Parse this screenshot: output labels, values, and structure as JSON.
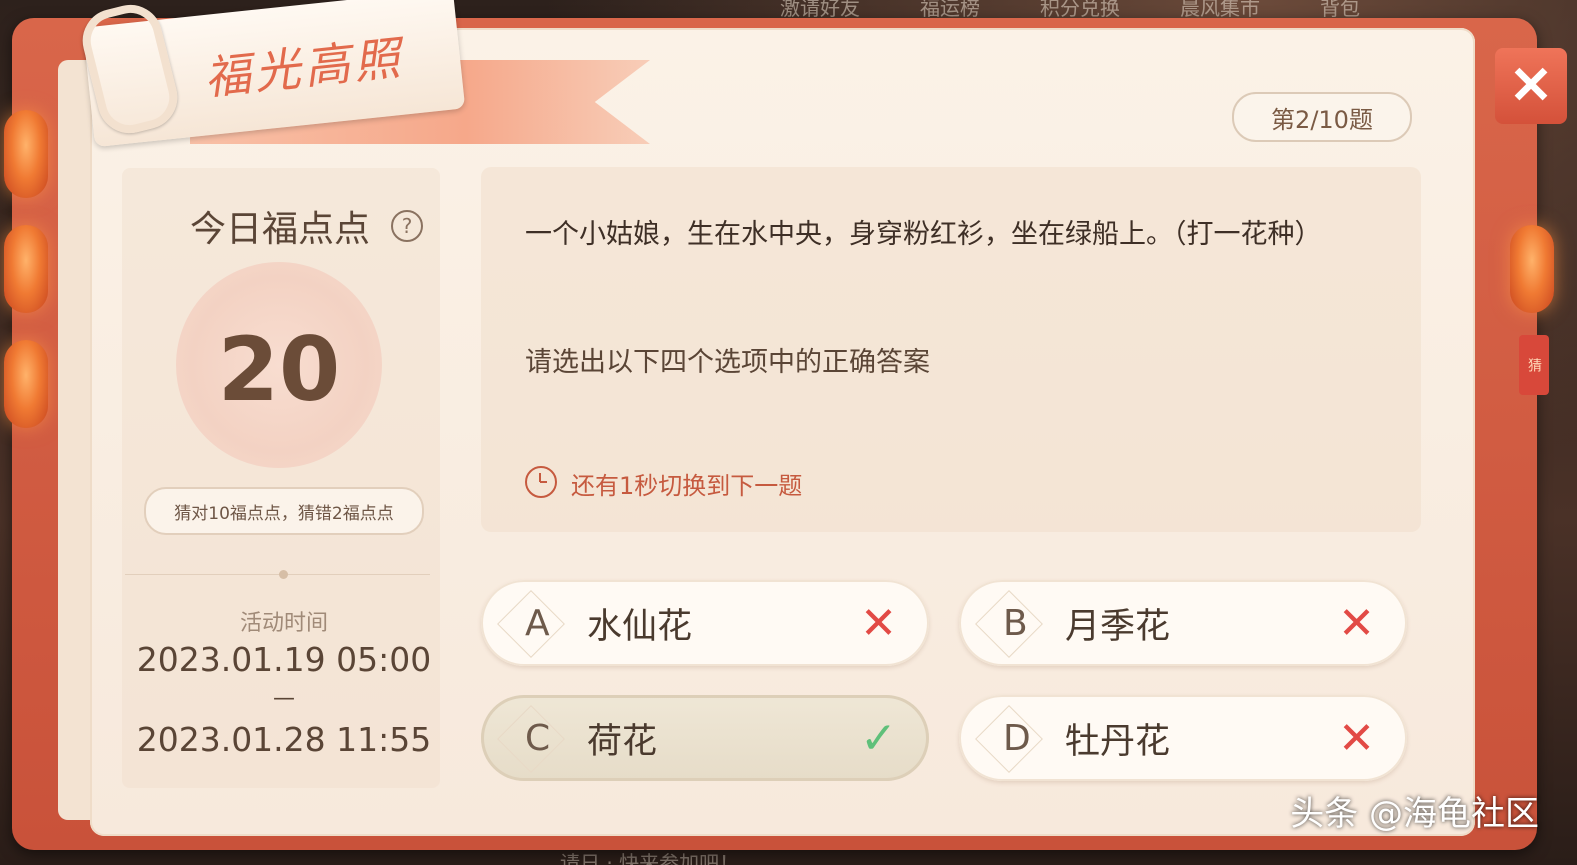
{
  "top_menu": [
    "激请好友",
    "福运榜",
    "积分兑换",
    "晨风集市",
    "背包"
  ],
  "bottom_strip": "请日 · 快来参加吧！",
  "title": "福光高照",
  "question_counter": "第2/10题",
  "points": {
    "label": "今日福点点",
    "help": "?",
    "value": "20",
    "rule": "猜对10福点点，猜错2福点点"
  },
  "activity": {
    "label": "活动时间",
    "start": "2023.01.19 05:00",
    "dash": "—",
    "end": "2023.01.28 11:55"
  },
  "question": {
    "text": "一个小姑娘，生在水中央，身穿粉红衫，坐在绿船上。（打一花种）",
    "instruction": "请选出以下四个选项中的正确答案",
    "timer": "还有1秒切换到下一题"
  },
  "options": [
    {
      "letter": "A",
      "label": "水仙花",
      "mark": "✕",
      "correct": false
    },
    {
      "letter": "B",
      "label": "月季花",
      "mark": "✕",
      "correct": false
    },
    {
      "letter": "C",
      "label": "荷花",
      "mark": "✓",
      "correct": true
    },
    {
      "letter": "D",
      "label": "牡丹花",
      "mark": "✕",
      "correct": false
    }
  ],
  "close": "✕",
  "side_tab": "猜",
  "watermark": "头条 @海龟社区",
  "colors": {
    "accent": "#e26a4c",
    "frame": "#d4513a",
    "wrong": "#e24a45",
    "right": "#5fc07a"
  }
}
